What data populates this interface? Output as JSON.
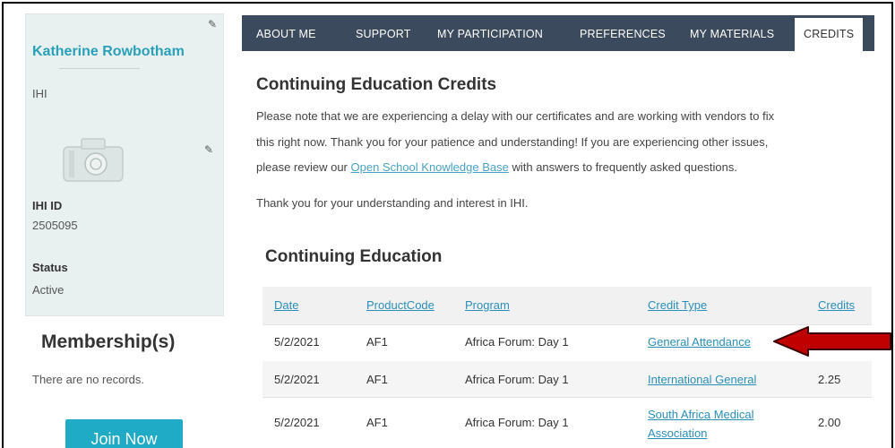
{
  "profile": {
    "name": "Katherine Rowbotham",
    "organization": "IHI",
    "id_label": "IHI ID",
    "id_value": "2505095",
    "status_label": "Status",
    "status_value": "Active"
  },
  "membership": {
    "title": "Membership(s)",
    "empty_text": "There are no records.",
    "join_label": "Join Now"
  },
  "nav": {
    "tabs": [
      "ABOUT ME",
      "SUPPORT",
      "MY PARTICIPATION",
      "PREFERENCES",
      "MY MATERIALS",
      "CREDITS"
    ],
    "active": "CREDITS"
  },
  "credits": {
    "title": "Continuing Education Credits",
    "notice_line1": "Please note that we are experiencing a delay with our certificates and are working with vendors to fix",
    "notice_line2": "this right now. Thank you for your patience and understanding! If you are experiencing other issues,",
    "notice_line3_before": "please review our ",
    "notice_link": "Open School Knowledge Base",
    "notice_line3_after": " with answers to frequently asked questions.",
    "thanks": "Thank you for your understanding and interest in IHI."
  },
  "table": {
    "title": "Continuing Education",
    "headers": [
      "Date",
      "ProductCode",
      "Program",
      "Credit Type",
      "Credits"
    ],
    "rows": [
      {
        "date": "5/2/2021",
        "code": "AF1",
        "program": "Africa Forum: Day 1",
        "credit_type": "General Attendance",
        "credits": ""
      },
      {
        "date": "5/2/2021",
        "code": "AF1",
        "program": "Africa Forum: Day 1",
        "credit_type": "International General",
        "credits": "2.25"
      },
      {
        "date": "5/2/2021",
        "code": "AF1",
        "program": "Africa Forum: Day 1",
        "credit_type_line1": "South Africa Medical",
        "credit_type_line2": "Association",
        "credits": "2.00"
      }
    ]
  },
  "colors": {
    "accent": "#2aa0b8",
    "nav_bg": "#3b4a5c",
    "card_bg": "#e8f1f0",
    "button_bg": "#1faac5",
    "arrow": "#c00000"
  }
}
